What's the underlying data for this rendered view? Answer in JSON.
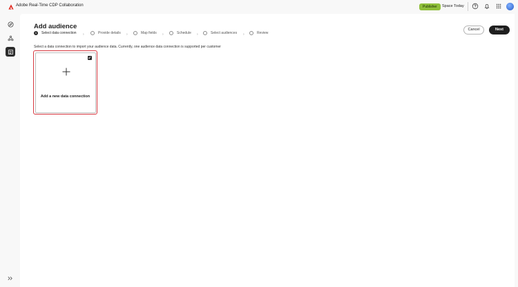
{
  "header": {
    "app_title": "Adobe Real-Time CDP Collaboration",
    "role_badge": "Publisher",
    "space_name": "Space Today",
    "icons": [
      "adobe-logo-icon",
      "help-icon",
      "bell-icon",
      "apps-grid-icon",
      "avatar"
    ]
  },
  "rail": {
    "items": [
      {
        "icon": "compass-icon",
        "active": false
      },
      {
        "icon": "connections-icon",
        "active": false
      },
      {
        "icon": "audiences-icon",
        "active": true
      }
    ],
    "expand_icon": "chevron-double-right-icon"
  },
  "page": {
    "title": "Add audience",
    "cancel_label": "Cancel",
    "next_label": "Next",
    "instructions": "Select a data connection to import your audience data. Currently, one audience data connection is supported per customer"
  },
  "steps": [
    {
      "label": "Select data connection",
      "number": "1",
      "current": true
    },
    {
      "label": "Provide details",
      "current": false
    },
    {
      "label": "Map fields",
      "current": false
    },
    {
      "label": "Schedule",
      "current": false
    },
    {
      "label": "Select audiences",
      "current": false
    },
    {
      "label": "Review",
      "current": false
    }
  ],
  "card": {
    "label": "Add a new data connection",
    "selected": true
  },
  "colors": {
    "accent_badge": "#8fbf3a",
    "selection_border": "#d7373f",
    "primary_button": "#1f1f1f"
  }
}
